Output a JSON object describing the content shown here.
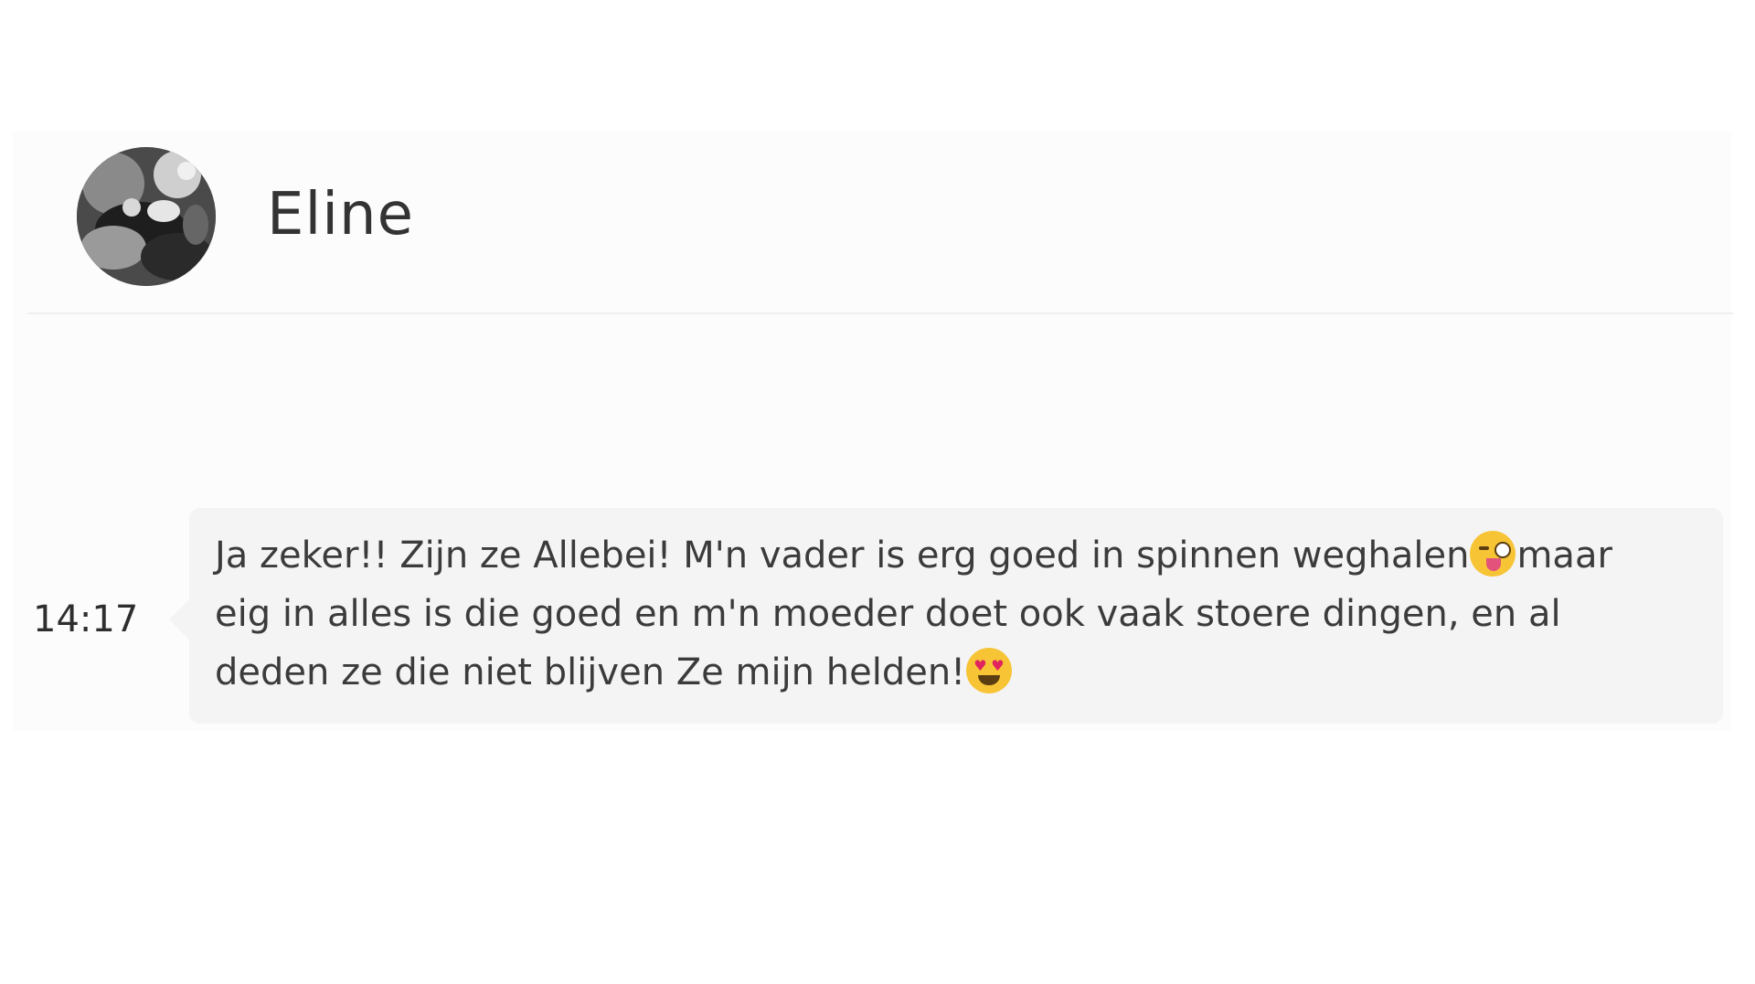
{
  "header": {
    "contact_name": "Eline",
    "avatar_icon": "user-avatar-photo"
  },
  "messages": [
    {
      "time": "14:17",
      "segments": [
        "Ja zeker!! Zijn ze Allebei! M'n vader is erg goed in spinnen weghalen",
        "maar\neig in alles is die goed en m'n moeder doet ook vaak stoere dingen, en al\ndeden ze die niet blijven Ze mijn helden!"
      ],
      "emojis": [
        "winking-face-with-tongue-emoji",
        "heart-eyes-emoji"
      ]
    }
  ],
  "colors": {
    "panel_background": "#fcfcfc",
    "bubble_background": "#f4f4f4",
    "text": "#3b3b3b"
  }
}
